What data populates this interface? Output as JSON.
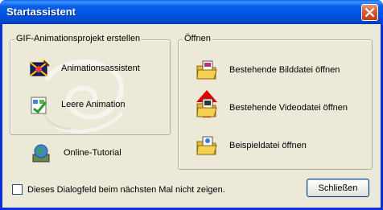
{
  "window": {
    "title": "Startassistent",
    "close_icon": "close-x-icon"
  },
  "left_group": {
    "title": "GIF-Animationsprojekt erstellen",
    "items": [
      {
        "label": "Animationsassistent",
        "icon": "animation-wizard-icon"
      },
      {
        "label": "Leere Animation",
        "icon": "blank-animation-icon"
      }
    ]
  },
  "online_tutorial": {
    "label": "Online-Tutorial",
    "icon": "globe-tutorial-icon"
  },
  "right_group": {
    "title": "Öffnen",
    "items": [
      {
        "label": "Bestehende Bilddatei öffnen",
        "icon": "open-image-folder-icon"
      },
      {
        "label": "Bestehende Videodatei öffnen",
        "icon": "open-video-folder-icon"
      },
      {
        "label": "Beispieldatei öffnen",
        "icon": "open-sample-folder-icon"
      }
    ]
  },
  "checkbox": {
    "label": "Dieses Dialogfeld beim nächsten Mal nicht zeigen.",
    "checked": false
  },
  "buttons": {
    "close_label": "Schließen"
  },
  "colors": {
    "titlebar": "#0054e3",
    "dialog_bg": "#ece9d8",
    "arrow": "#e00000",
    "group_border": "#b0ae9e"
  }
}
